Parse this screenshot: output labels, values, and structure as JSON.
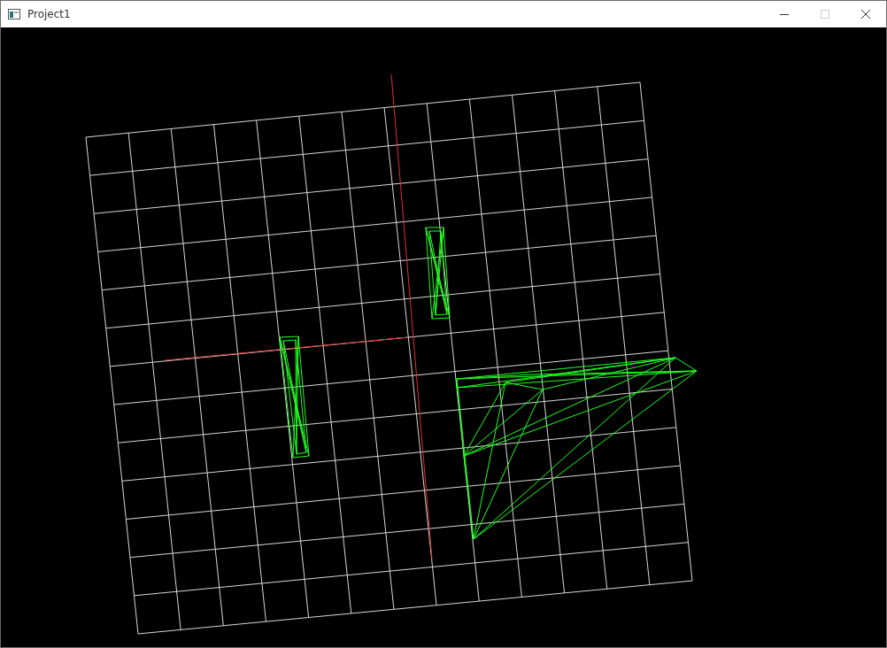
{
  "window": {
    "title": "Project1",
    "maximize_disabled": true
  }
}
